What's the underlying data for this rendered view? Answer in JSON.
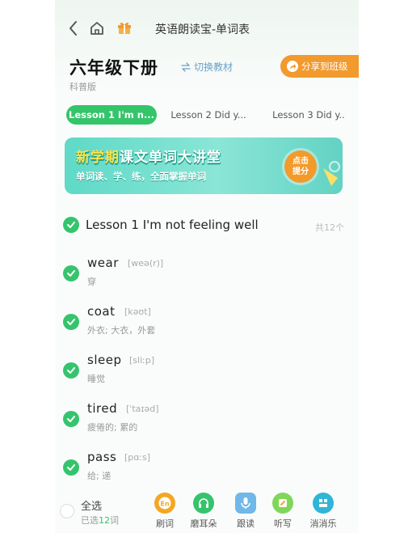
{
  "topbar": {
    "title": "英语朗读宝-单词表"
  },
  "book": {
    "title": "六年级下册",
    "edition": "科普版",
    "switch_label": "切换教材",
    "share_label": "分享到班级"
  },
  "tabs": [
    {
      "label": "Lesson 1 I'm n...",
      "active": true
    },
    {
      "label": "Lesson 2 Did y...",
      "active": false
    },
    {
      "label": "Lesson 3 Did y..",
      "active": false
    }
  ],
  "banner": {
    "title_prefix": "新学期",
    "title_rest": "课文单词大讲堂",
    "subtitle": "单词读、学、练，全面掌握单词",
    "cta_line1": "点击",
    "cta_line2": "提分"
  },
  "lesson": {
    "title": "Lesson 1 I'm not feeling well",
    "count": "共12个"
  },
  "words": [
    {
      "word": "wear",
      "phonetic": "[weə(r)]",
      "meaning": "穿"
    },
    {
      "word": "coat",
      "phonetic": "[kəʊt]",
      "meaning": "外衣; 大衣，外套"
    },
    {
      "word": "sleep",
      "phonetic": "[sliːp]",
      "meaning": "睡觉"
    },
    {
      "word": "tired",
      "phonetic": "[ˈtaɪəd]",
      "meaning": "疲倦的; 累的"
    },
    {
      "word": "pass",
      "phonetic": "[pɑːs]",
      "meaning": "给; 递"
    }
  ],
  "bottom": {
    "select_all": "全选",
    "selected_prefix": "已选",
    "selected_num": "12",
    "selected_suffix": "词",
    "tools": [
      {
        "label": "刷词",
        "icon": "word-en-icon",
        "color": "#f5a623"
      },
      {
        "label": "磨耳朵",
        "icon": "headphones-icon",
        "color": "#35c46d"
      },
      {
        "label": "跟读",
        "icon": "microphone-icon",
        "color": "#6fb8e8"
      },
      {
        "label": "听写",
        "icon": "pencil-icon",
        "color": "#7fd65a"
      },
      {
        "label": "消消乐",
        "icon": "game-icon",
        "color": "#2fb5d6"
      }
    ]
  },
  "colors": {
    "accent": "#35c46d",
    "share": "#f29a2e",
    "banner": "#5fd9c7"
  }
}
